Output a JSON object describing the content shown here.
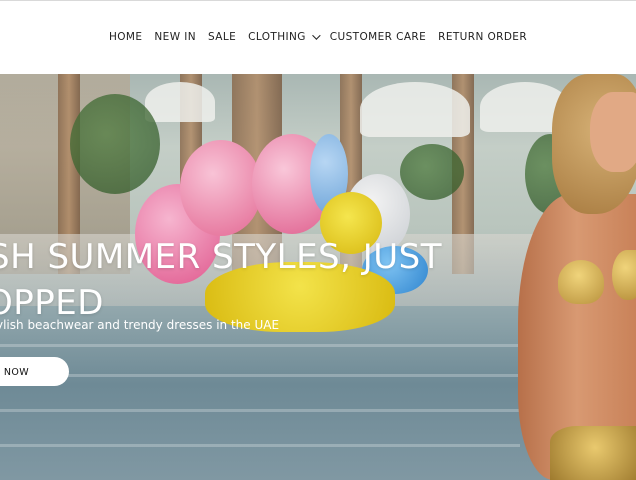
{
  "nav": {
    "items": [
      {
        "label": "HOME"
      },
      {
        "label": "NEW IN"
      },
      {
        "label": "SALE"
      },
      {
        "label": "CLOTHING",
        "has_dropdown": true,
        "icon": "chevron-down-icon"
      },
      {
        "label": "CUSTOMER CARE"
      },
      {
        "label": "RETURN ORDER"
      }
    ]
  },
  "hero": {
    "headline_line1": "SH SUMMER STYLES, JUST",
    "headline_line2": "OPPED",
    "subtitle": "ylish beachwear and trendy dresses in the UAE",
    "cta_label": "P NOW"
  },
  "colors": {
    "nav_text": "#222222",
    "hero_text": "#ffffff",
    "cta_bg": "#ffffff"
  }
}
